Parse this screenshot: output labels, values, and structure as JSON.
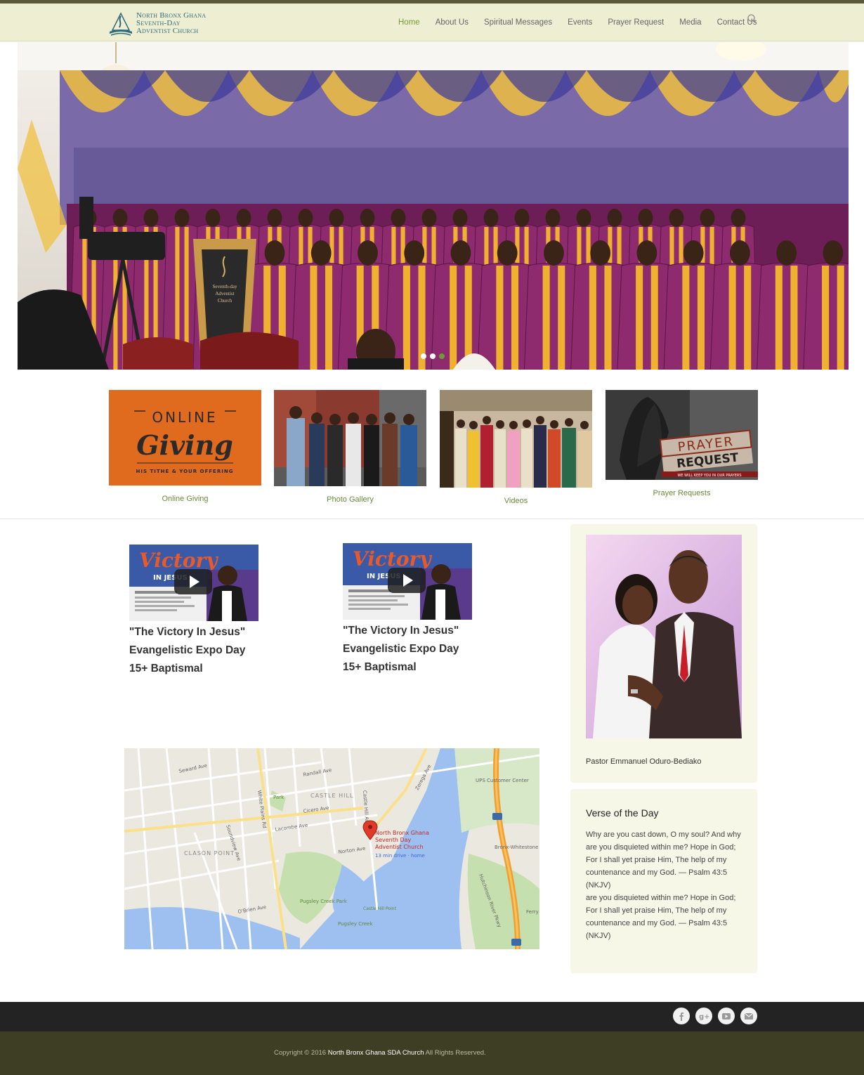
{
  "site": {
    "logo_lines": [
      "North Bronx Ghana",
      "Seventh-Day",
      "Adventist Church"
    ]
  },
  "nav": {
    "items": [
      "Home",
      "About Us",
      "Spiritual Messages",
      "Events",
      "Prayer Request",
      "Media",
      "Contact Us"
    ],
    "active": "Home"
  },
  "hero": {
    "slides": 3,
    "active_slide": 3,
    "pulpit_text": [
      "Seventh-day",
      "Adventist",
      "Church"
    ]
  },
  "tiles": [
    {
      "label": "Online Giving",
      "art": {
        "top": "ONLINE",
        "main": "Giving",
        "sub": "HIS TITHE & YOUR OFFERING"
      }
    },
    {
      "label": "Photo Gallery"
    },
    {
      "label": "Videos"
    },
    {
      "label": "Prayer Requests",
      "art": {
        "word1": "PRAYER",
        "word2": "REQUEST",
        "sub": "WE WILL KEEP YOU IN OUR PRAYERS"
      }
    }
  ],
  "videos": [
    {
      "title_lines": [
        "\"The Victory In Jesus\"",
        "Evangelistic Expo Day",
        "15+ Baptismal"
      ],
      "thumb_word": "Victory",
      "thumb_word2": "IN JESUS"
    },
    {
      "title_lines": [
        "\"The Victory In Jesus\"",
        "Evangelistic Expo Day",
        "15+ Baptismal"
      ],
      "thumb_word": "Victory",
      "thumb_word2": "IN JESUS"
    }
  ],
  "map": {
    "place_lines": [
      "North Bronx Ghana",
      "Seventh Day",
      "Adventist Church"
    ],
    "drive": "13 min drive · home",
    "labels": {
      "randall": "Randall Ave",
      "castle_hill": "CASTLE HILL",
      "clason": "CLASON POINT",
      "park": "Park",
      "pugsley_park": "Pugsley Creek Park",
      "pugsley_creek": "Pugsley Creek",
      "ups": "UPS Customer Center",
      "bronx_whitestone": "Bronx-Whitestone",
      "hutchinson": "Hutchinson River Pkwy",
      "white_plains": "White Plains Rd",
      "soundview": "Soundview Ave",
      "castle_hill_ave": "Castle Hill Ave",
      "lacombe": "Lacombe Ave",
      "cicero": "Cicero Ave",
      "seward": "Seward Ave",
      "zerega": "Zerega Ave",
      "norton": "Norton Ave",
      "obrien": "O'Brien Ave",
      "ferry": "Ferry",
      "castle_hill_point": "Castle Hill Point"
    }
  },
  "sidebar": {
    "pastor_name": "Pastor Emmanuel Oduro-Bediako",
    "verse_title": "Verse of the Day",
    "verse_text": "Why are you cast down, O my soul? And why are you disquieted within me? Hope in God; For I shall yet praise Him, The help of my countenance and my God. — Psalm 43:5 (NKJV)",
    "verse_text_repeat": "are you disquieted within me? Hope in God; For I shall yet praise Him, The help of my countenance and my God. — Psalm 43:5 (NKJV)"
  },
  "social": [
    "facebook-icon",
    "google-plus-icon",
    "youtube-icon",
    "email-icon"
  ],
  "footer": {
    "copyright_prefix": "Copyright © 2016 ",
    "org": "North Bronx Ghana SDA Church",
    "copyright_suffix": " All Rights Reserved."
  },
  "colors": {
    "header_bg": "#eeeed2",
    "accent_green": "#7a9a3a",
    "footer_dark": "#232323",
    "footer_olive": "#3e3e24",
    "robe_purple": "#8e2a6e",
    "stole_gold": "#f0b030",
    "giving_orange": "#e06a1e"
  }
}
